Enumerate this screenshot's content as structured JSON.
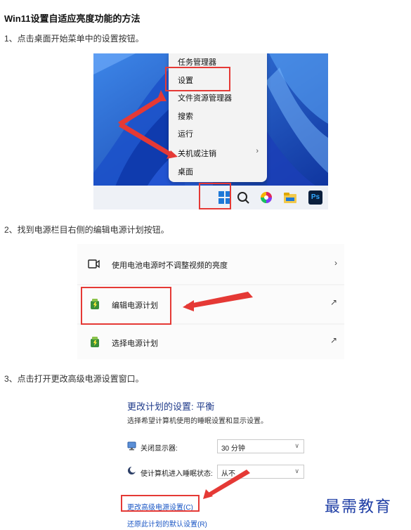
{
  "article": {
    "title": "Win11设置自适应亮度功能的方法",
    "step1": "1、点击桌面开始菜单中的设置按钮。",
    "step2": "2、找到电源栏目右侧的编辑电源计划按钮。",
    "step3": "3、点击打开更改高级电源设置窗口。"
  },
  "context_menu": {
    "items": [
      "任务管理器",
      "设置",
      "文件资源管理器",
      "搜索",
      "运行",
      "关机或注销",
      "桌面"
    ],
    "submenu_chevron": "›",
    "highlighted_item": "设置"
  },
  "taskbar": {
    "icons": [
      "windows-start-icon",
      "search-icon",
      "color-wheel-icon",
      "file-explorer-icon",
      "photoshop-icon"
    ],
    "photoshop_label": "Ps"
  },
  "power_settings": {
    "rows": [
      {
        "label": "使用电池电源时不调整视频的亮度",
        "icon": "video-icon",
        "right": "›"
      },
      {
        "label": "编辑电源计划",
        "icon": "power-plan-icon",
        "right": "↗"
      },
      {
        "label": "选择电源计划",
        "icon": "power-plan-icon",
        "right": "↗"
      }
    ]
  },
  "plan_settings": {
    "title": "更改计划的设置: 平衡",
    "description": "选择希望计算机使用的睡眠设置和显示设置。",
    "display_off_label": "关闭显示器:",
    "display_off_value": "30 分钟",
    "sleep_label": "使计算机进入睡眠状态:",
    "sleep_value": "从不",
    "advanced_link": "更改高级电源设置(C)",
    "restore_link": "还原此计划的默认设置(R)"
  },
  "watermark": "最需教育",
  "colors": {
    "highlight_red": "#e53935",
    "link_blue": "#1a56c4",
    "title_blue": "#1e3a8a",
    "wallpaper_blue": "#2b6fd4"
  }
}
